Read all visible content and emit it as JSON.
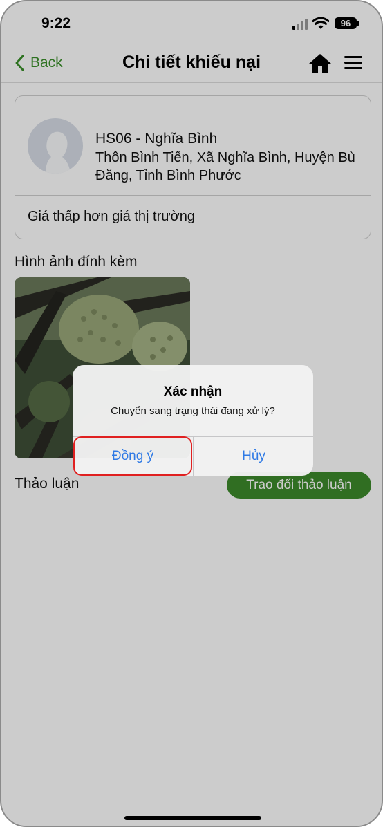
{
  "status_bar": {
    "time": "9:22",
    "battery": "96"
  },
  "nav": {
    "back_label": "Back",
    "title": "Chi tiết khiếu nại"
  },
  "profile": {
    "name": "HS06 - Nghĩa Bình",
    "address": "Thôn Bình Tiến, Xã Nghĩa Bình, Huyện Bù Đăng, Tỉnh Bình Phước",
    "complaint": "Giá thấp hơn giá thị trường"
  },
  "attachments": {
    "title": "Hình ảnh đính kèm"
  },
  "discussion": {
    "title": "Thảo luận",
    "button_label": "Trao đổi thảo luận"
  },
  "dialog": {
    "title": "Xác nhận",
    "message": "Chuyển sang trạng thái đang xử lý?",
    "confirm_label": "Đồng ý",
    "cancel_label": "Hủy"
  },
  "colors": {
    "accent_green": "#3d8a2b",
    "link_blue": "#2f7ae5",
    "highlight_red": "#e02020"
  }
}
